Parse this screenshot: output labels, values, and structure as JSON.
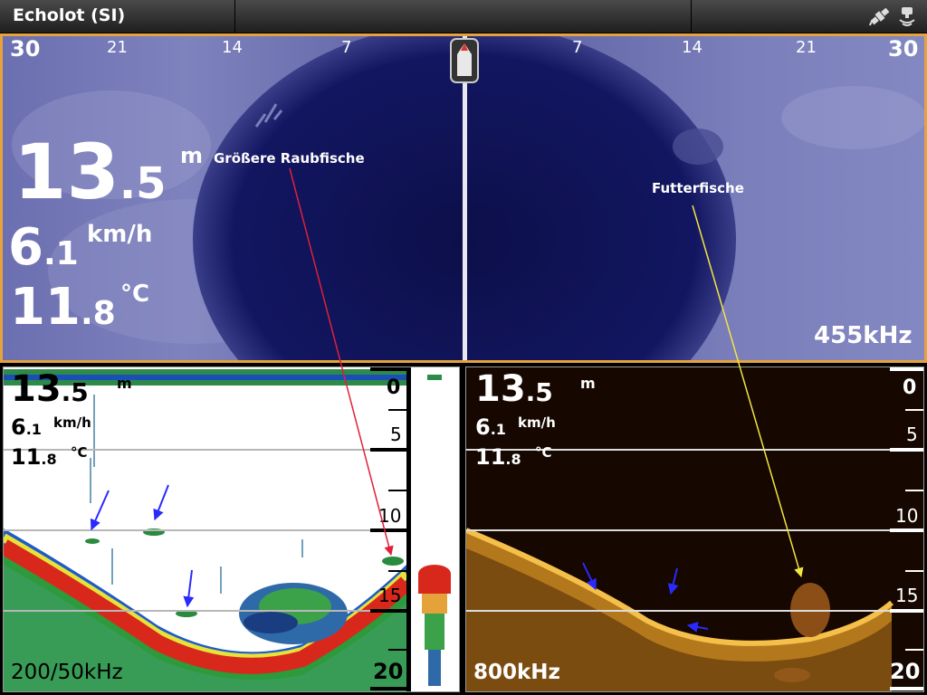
{
  "app": {
    "title": "Echolot (SI)"
  },
  "side_imaging": {
    "range_left": [
      "30",
      "21",
      "14",
      "7"
    ],
    "range_right": [
      "7",
      "14",
      "21",
      "30"
    ],
    "depth_value": "13",
    "depth_decimal": ".5",
    "depth_unit": "m",
    "speed_value": "6",
    "speed_decimal": ".1",
    "speed_unit": "km/h",
    "temp_value": "11",
    "temp_decimal": ".8",
    "temp_unit": "°C",
    "frequency": "455kHz"
  },
  "sonar_2d": {
    "depth_value": "13",
    "depth_decimal": ".5",
    "depth_unit": "m",
    "speed_value": "6",
    "speed_decimal": ".1",
    "speed_unit": "km/h",
    "temp_value": "11",
    "temp_decimal": ".8",
    "temp_unit": "°C",
    "depth_scale": [
      "0",
      "5",
      "10",
      "15",
      "20"
    ],
    "frequency": "200/50kHz"
  },
  "down_imaging": {
    "depth_value": "13",
    "depth_decimal": ".5",
    "depth_unit": "m",
    "speed_value": "6",
    "speed_decimal": ".1",
    "speed_unit": "km/h",
    "temp_value": "11",
    "temp_decimal": ".8",
    "temp_unit": "°C",
    "depth_scale": [
      "0",
      "5",
      "10",
      "15",
      "20"
    ],
    "frequency": "800kHz"
  },
  "annotations": {
    "predator_label": "Größere Raubfische",
    "bait_label": "Futterfische",
    "predator_color": "#e0203a",
    "bait_color": "#f2e640",
    "fish_arrow_color": "#2a2aff"
  },
  "icons": [
    "gps-satellite-icon",
    "sonar-transducer-icon",
    "boat-icon"
  ]
}
